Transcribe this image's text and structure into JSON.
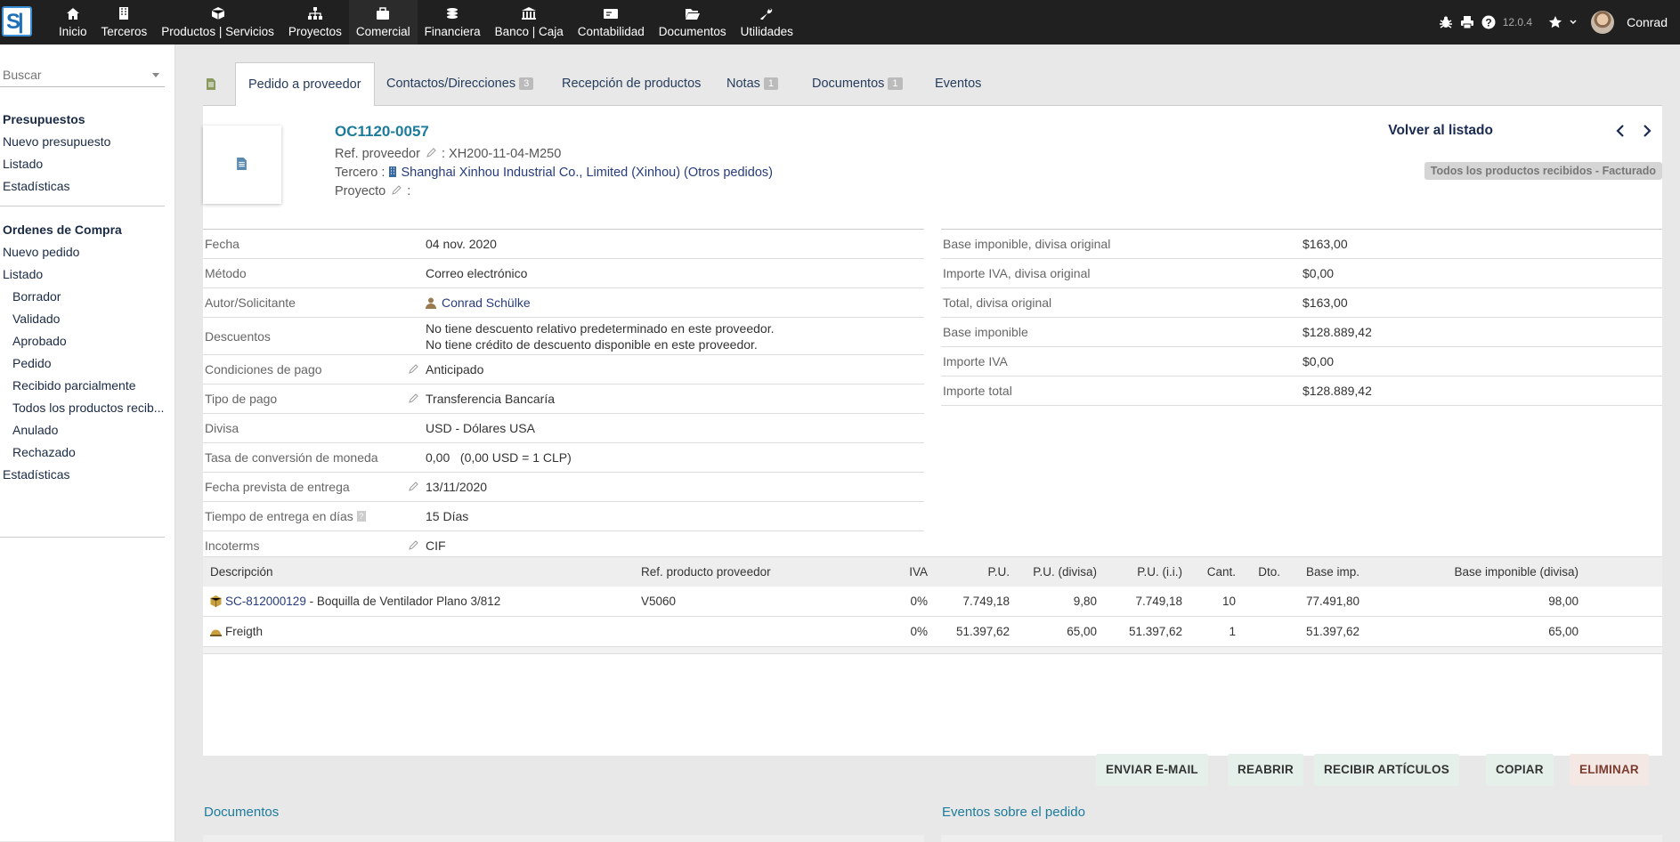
{
  "topbar": {
    "menu": [
      {
        "label": "Inicio",
        "icon": "home-icon"
      },
      {
        "label": "Terceros",
        "icon": "building-icon"
      },
      {
        "label": "Productos | Servicios",
        "icon": "cube-icon"
      },
      {
        "label": "Proyectos",
        "icon": "sitemap-icon"
      },
      {
        "label": "Comercial",
        "icon": "suitcase-icon"
      },
      {
        "label": "Financiera",
        "icon": "coins-icon"
      },
      {
        "label": "Banco | Caja",
        "icon": "bank-icon"
      },
      {
        "label": "Contabilidad",
        "icon": "money-check-icon"
      },
      {
        "label": "Documentos",
        "icon": "folder-open-icon"
      },
      {
        "label": "Utilidades",
        "icon": "wrench-icon"
      }
    ],
    "active_menu": "Comercial",
    "version": "12.0.4",
    "user": "Conrad"
  },
  "sidebar": {
    "search_placeholder": "Buscar",
    "sections": [
      {
        "title": "Presupuestos",
        "links": [
          {
            "label": "Nuevo presupuesto"
          },
          {
            "label": "Listado"
          },
          {
            "label": "Estadísticas"
          }
        ]
      },
      {
        "title": "Ordenes de Compra",
        "links": [
          {
            "label": "Nuevo pedido"
          },
          {
            "label": "Listado"
          },
          {
            "label": "Borrador",
            "sub": true
          },
          {
            "label": "Validado",
            "sub": true
          },
          {
            "label": "Aprobado",
            "sub": true
          },
          {
            "label": "Pedido",
            "sub": true
          },
          {
            "label": "Recibido parcialmente",
            "sub": true
          },
          {
            "label": "Todos los productos recib...",
            "sub": true
          },
          {
            "label": "Anulado",
            "sub": true
          },
          {
            "label": "Rechazado",
            "sub": true
          },
          {
            "label": "Estadísticas"
          }
        ]
      }
    ]
  },
  "tabs": [
    {
      "label": "Pedido a proveedor",
      "active": true
    },
    {
      "label": "Contactos/Direcciones",
      "badge": "3"
    },
    {
      "label": "Recepción de productos"
    },
    {
      "label": "Notas",
      "badge": "1"
    },
    {
      "label": "Documentos",
      "badge": "1"
    },
    {
      "label": "Eventos"
    }
  ],
  "header": {
    "ref": "OC1120-0057",
    "ref_supplier_label": "Ref. proveedor",
    "ref_supplier_value": ": XH200-11-04-M250",
    "third_label": "Tercero :",
    "third_value": "Shanghai Xinhou Industrial Co., Limited (Xinhou) (Otros pedidos)",
    "project_label": "Proyecto",
    "project_value": ":",
    "back_label": "Volver al listado",
    "status": "Todos los productos recibidos - Facturado"
  },
  "fields_left": [
    {
      "label": "Fecha",
      "value": "04 nov. 2020"
    },
    {
      "label": "Método",
      "value": "Correo electrónico"
    },
    {
      "label": "Autor/Solicitante",
      "value": "Conrad Schülke",
      "user": true
    },
    {
      "label": "Descuentos",
      "value": "No tiene descuento relativo predeterminado en este proveedor.",
      "value2": "No tiene crédito de descuento disponible en este proveedor."
    },
    {
      "label": "Condiciones de pago",
      "value": "Anticipado",
      "edit": true
    },
    {
      "label": "Tipo de pago",
      "value": "Transferencia Bancaría",
      "edit": true
    },
    {
      "label": "Divisa",
      "value": "USD - Dólares USA"
    },
    {
      "label": "Tasa de conversión de moneda",
      "value": "0,00   (0,00 USD = 1 CLP)"
    },
    {
      "label": "Fecha prevista de entrega",
      "value": "13/11/2020",
      "edit": true
    },
    {
      "label": "Tiempo de entrega en días",
      "value": "15 Días",
      "help": true
    },
    {
      "label": "Incoterms",
      "value": "CIF",
      "edit": true
    }
  ],
  "fields_right": [
    {
      "label": "Base imponible, divisa original",
      "value": "$163,00"
    },
    {
      "label": "Importe IVA, divisa original",
      "value": "$0,00"
    },
    {
      "label": "Total, divisa original",
      "value": "$163,00"
    },
    {
      "label": "Base imponible",
      "value": "$128.889,42"
    },
    {
      "label": "Importe IVA",
      "value": "$0,00"
    },
    {
      "label": "Importe total",
      "value": "$128.889,42"
    }
  ],
  "lines": {
    "headers": [
      "Descripción",
      "Ref. producto proveedor",
      "IVA",
      "P.U.",
      "P.U. (divisa)",
      "P.U. (i.i.)",
      "Cant.",
      "Dto.",
      "Base imp.",
      "Base imponible (divisa)"
    ],
    "rows": [
      {
        "ref": "SC-812000129",
        "desc": " - Boquilla de Ventilador Plano 3/812",
        "supplier_ref": "V5060",
        "iva": "0%",
        "pu": "7.749,18",
        "pu_currency": "9,80",
        "pu_ii": "7.749,18",
        "qty": "10",
        "disc": "",
        "base": "77.491,80",
        "base_currency": "98,00",
        "icon": "product-icon"
      },
      {
        "ref": "",
        "desc": "Freigth",
        "supplier_ref": "",
        "iva": "0%",
        "pu": "51.397,62",
        "pu_currency": "65,00",
        "pu_ii": "51.397,62",
        "qty": "1",
        "disc": "",
        "base": "51.397,62",
        "base_currency": "65,00",
        "icon": "service-icon"
      }
    ]
  },
  "buttons": {
    "send_email": "ENVIAR E-MAIL",
    "reopen": "REABRIR",
    "receive": "RECIBIR ARTÍCULOS",
    "copy": "COPIAR",
    "delete": "ELIMINAR"
  },
  "bottom": {
    "documents_title": "Documentos",
    "events_title": "Eventos sobre el pedido"
  }
}
